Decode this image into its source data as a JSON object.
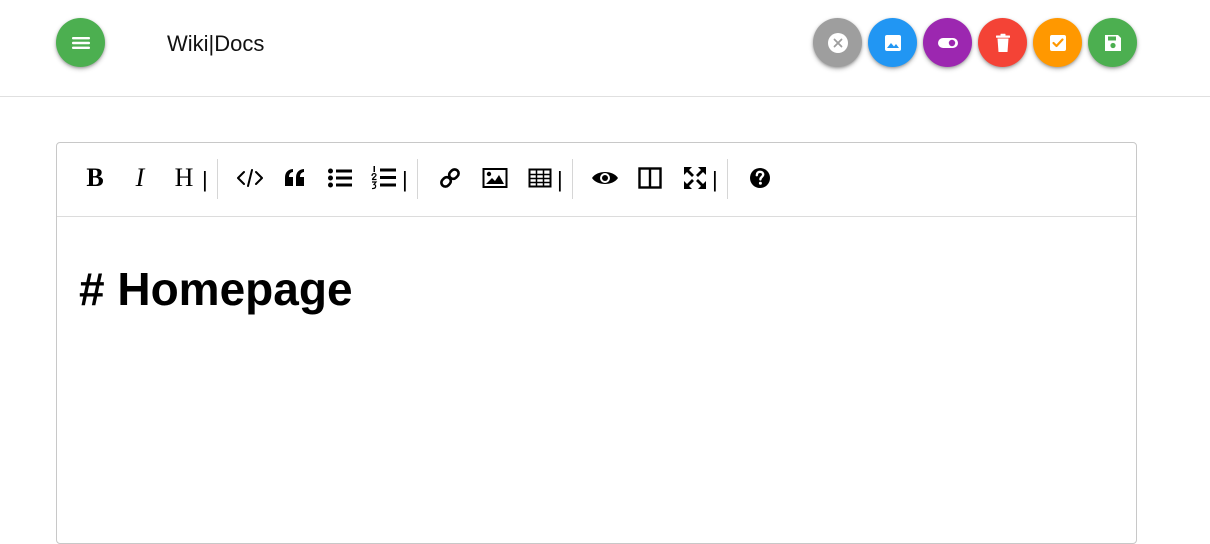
{
  "header": {
    "brand": "Wiki|Docs",
    "menu_icon": "hamburger-menu-icon",
    "actions": [
      {
        "name": "close",
        "icon": "close-circle-icon",
        "color": "#9e9e9e"
      },
      {
        "name": "insert-image",
        "icon": "image-icon",
        "color": "#2196f3"
      },
      {
        "name": "toggle",
        "icon": "toggle-icon",
        "color": "#9c27b0"
      },
      {
        "name": "delete",
        "icon": "trash-icon",
        "color": "#f44336"
      },
      {
        "name": "done",
        "icon": "checkbox-icon",
        "color": "#ff9800"
      },
      {
        "name": "save",
        "icon": "floppy-disk-icon",
        "color": "#4caf50"
      }
    ]
  },
  "toolbar": {
    "bold": "B",
    "italic": "I",
    "heading": "H",
    "icons": [
      "bold-icon",
      "italic-icon",
      "heading-icon",
      "code-icon",
      "quote-icon",
      "bullet-list-icon",
      "numbered-list-icon",
      "link-icon",
      "image-icon",
      "table-icon",
      "preview-eye-icon",
      "side-by-side-icon",
      "fullscreen-icon",
      "help-icon"
    ]
  },
  "editor": {
    "content": "# Homepage"
  }
}
